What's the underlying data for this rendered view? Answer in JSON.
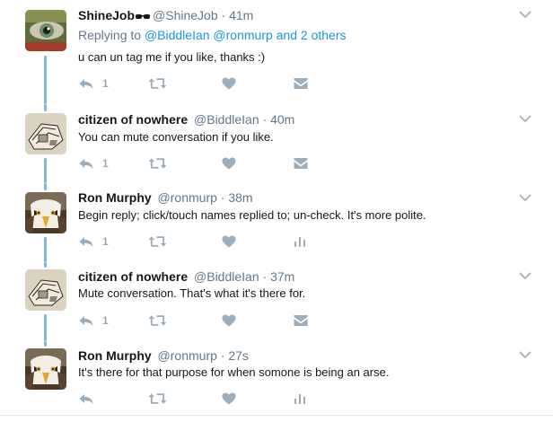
{
  "tweets": [
    {
      "name": "ShineJob",
      "name_suffix_icon": "sunglasses-icon",
      "handle": "@ShineJob",
      "separator": "·",
      "time": "41m",
      "reply_prefix": "Replying to",
      "reply_handle_1": "@BiddleIan",
      "reply_handle_2": "@ronmurp",
      "reply_suffix": "and 2 others",
      "text": "u can un tag me if you like, thanks :)",
      "reply_count": "1",
      "fourth_action_icon": "message-icon"
    },
    {
      "name": "citizen of nowhere",
      "handle": "@BiddleIan",
      "separator": "·",
      "time": "40m",
      "text": "You can mute conversation if you like.",
      "reply_count": "1",
      "fourth_action_icon": "message-icon"
    },
    {
      "name": "Ron Murphy",
      "handle": "@ronmurp",
      "separator": "·",
      "time": "38m",
      "text": "Begin reply; click/touch names replied to; un-check. It's more polite.",
      "reply_count": "1",
      "fourth_action_icon": "analytics-icon"
    },
    {
      "name": "citizen of nowhere",
      "handle": "@BiddleIan",
      "separator": "·",
      "time": "37m",
      "text": "Mute conversation. That's what it's there for.",
      "reply_count": "1",
      "fourth_action_icon": "message-icon"
    },
    {
      "name": "Ron Murphy",
      "handle": "@ronmurp",
      "separator": "·",
      "time": "27s",
      "text": "It's there for that purpose for when somone is being an arse.",
      "reply_count": "",
      "fourth_action_icon": "analytics-icon"
    }
  ],
  "colors": {
    "link": "#1b95e0",
    "thread_line": "#7fb5da",
    "icon_gray": "#9cadbb",
    "secondary_text": "#657786"
  }
}
